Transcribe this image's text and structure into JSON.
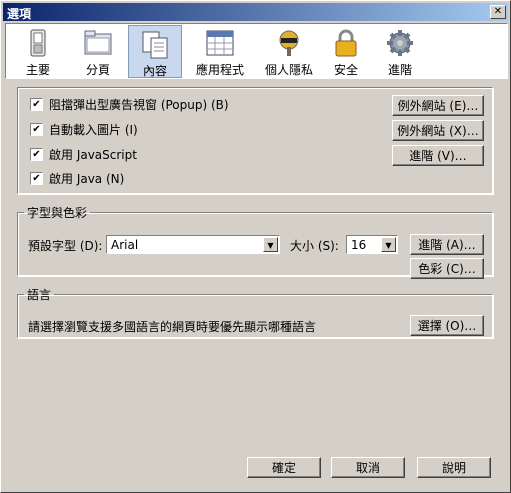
{
  "window": {
    "title": "選項",
    "close_label": "✕"
  },
  "toolbar": {
    "tabs": [
      {
        "label": "主要",
        "icon": "switch-icon"
      },
      {
        "label": "分頁",
        "icon": "folder-tabs-icon"
      },
      {
        "label": "內容",
        "icon": "content-page-icon"
      },
      {
        "label": "應用程式",
        "icon": "calendar-grid-icon"
      },
      {
        "label": "個人隱私",
        "icon": "mask-icon"
      },
      {
        "label": "安全",
        "icon": "lock-icon"
      },
      {
        "label": "進階",
        "icon": "gear-icon"
      }
    ],
    "selected": "內容"
  },
  "content": {
    "popup_label": "阻擋彈出型廣告視窗 (Popup) (B)",
    "images_label": "自動載入圖片 (I)",
    "js_label": "啟用 JavaScript",
    "java_label": "啟用 Java (N)",
    "popup_checked": "✔",
    "images_checked": "✔",
    "js_checked": "✔",
    "java_checked": "✔",
    "exceptions1_label": "例外網站 (E)…",
    "exceptions2_label": "例外網站 (X)…",
    "advanced_label": "進階 (V)…"
  },
  "fonts": {
    "legend": "字型與色彩",
    "default_font_label": "預設字型 (D):",
    "default_font_value": "Arial",
    "size_label": "大小 (S):",
    "size_value": "16",
    "advanced_label": "進階 (A)…",
    "colors_label": "色彩 (C)…"
  },
  "languages": {
    "legend": "語言",
    "description": "請選擇瀏覽支援多國語言的網頁時要優先顯示哪種語言",
    "choose_label": "選擇 (O)…"
  },
  "footer": {
    "ok_label": "確定",
    "cancel_label": "取消",
    "help_label": "說明"
  }
}
